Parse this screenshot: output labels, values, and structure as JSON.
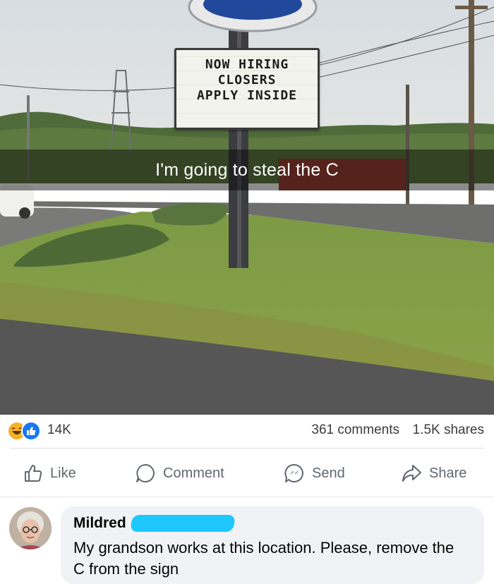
{
  "post": {
    "snap_caption": "I'm going to steal the C",
    "sign": {
      "line1": "NOW  HIRING",
      "line2": "CLOSERS",
      "line3": "APPLY  INSIDE"
    }
  },
  "reactions": {
    "count": "14K",
    "types": [
      "haha-icon",
      "like-icon"
    ]
  },
  "engagement": {
    "comments": "361 comments",
    "shares": "1.5K shares"
  },
  "actions": {
    "like": "Like",
    "comment": "Comment",
    "send": "Send",
    "share": "Share"
  },
  "comment": {
    "author": "Mildred",
    "text": "My grandson works at this location. Please, remove the C from the sign"
  },
  "colors": {
    "fb_blue": "#1877f2",
    "redaction": "#1ec8ff",
    "bubble_bg": "#f0f2f5"
  }
}
